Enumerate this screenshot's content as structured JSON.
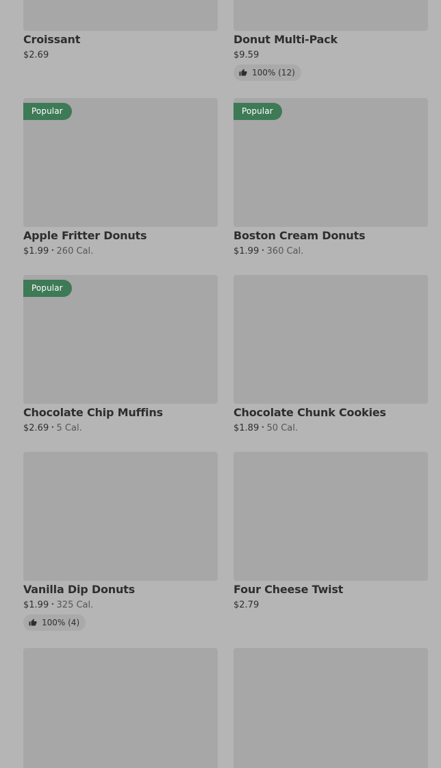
{
  "items": [
    {
      "name": "Croissant",
      "price": "$2.69",
      "calories": "",
      "popular": false,
      "rating": ""
    },
    {
      "name": "Donut Multi-Pack",
      "price": "$9.59",
      "calories": "",
      "popular": false,
      "rating": "100% (12)"
    },
    {
      "name": "Apple Fritter Donuts",
      "price": "$1.99",
      "calories": "260 Cal.",
      "popular": true,
      "rating": ""
    },
    {
      "name": "Boston Cream Donuts",
      "price": "$1.99",
      "calories": "360 Cal.",
      "popular": true,
      "rating": ""
    },
    {
      "name": "Chocolate Chip Muffins",
      "price": "$2.69",
      "calories": "5 Cal.",
      "popular": true,
      "rating": ""
    },
    {
      "name": "Chocolate Chunk Cookies",
      "price": "$1.89",
      "calories": "50 Cal.",
      "popular": false,
      "rating": ""
    },
    {
      "name": "Vanilla Dip Donuts",
      "price": "$1.99",
      "calories": "325 Cal.",
      "popular": false,
      "rating": "100% (4)"
    },
    {
      "name": "Four Cheese Twist",
      "price": "$2.79",
      "calories": "",
      "popular": false,
      "rating": ""
    }
  ],
  "badge_label": "Popular",
  "separator": "•",
  "colors": {
    "badge": "#3d7a55",
    "background": "#b5b5b5",
    "thumbnail": "#a7a7a7"
  },
  "icons": {
    "rating": "thumbs-up-icon"
  }
}
